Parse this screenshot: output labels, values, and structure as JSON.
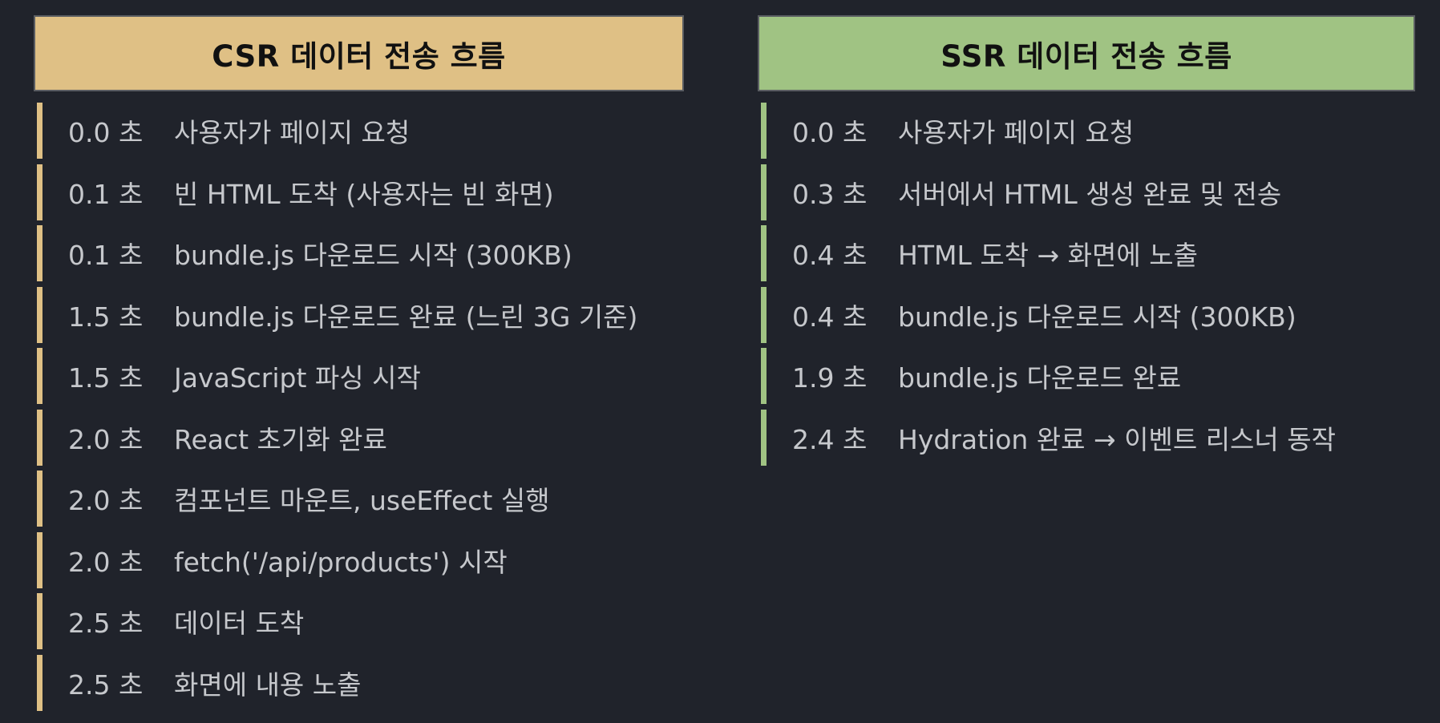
{
  "colors": {
    "background": "#20232b",
    "csr_accent": "#dfc085",
    "ssr_accent": "#a0c383",
    "text": "#c6c8cc"
  },
  "csr": {
    "title": "CSR 데이터 전송 흐름",
    "steps": [
      {
        "time": "0.0 초",
        "desc": "사용자가 페이지 요청"
      },
      {
        "time": "0.1 초",
        "desc": "빈 HTML 도착 (사용자는 빈 화면)"
      },
      {
        "time": "0.1 초",
        "desc": "bundle.js 다운로드 시작 (300KB)"
      },
      {
        "time": "1.5 초",
        "desc": "bundle.js 다운로드 완료 (느린 3G 기준)"
      },
      {
        "time": "1.5 초",
        "desc": "JavaScript 파싱 시작"
      },
      {
        "time": "2.0 초",
        "desc": "React 초기화 완료"
      },
      {
        "time": "2.0 초",
        "desc": "컴포넌트 마운트, useEffect 실행"
      },
      {
        "time": "2.0 초",
        "desc": "fetch('/api/products') 시작"
      },
      {
        "time": "2.5 초",
        "desc": "데이터 도착"
      },
      {
        "time": "2.5 초",
        "desc": "화면에 내용 노출"
      }
    ]
  },
  "ssr": {
    "title": "SSR 데이터 전송 흐름",
    "steps": [
      {
        "time": "0.0 초",
        "desc": "사용자가 페이지 요청"
      },
      {
        "time": "0.3 초",
        "desc": "서버에서 HTML 생성 완료 및 전송"
      },
      {
        "time": "0.4 초",
        "desc": "HTML 도착 → 화면에 노출"
      },
      {
        "time": "0.4 초",
        "desc": "bundle.js 다운로드 시작 (300KB)"
      },
      {
        "time": "1.9 초",
        "desc": "bundle.js 다운로드 완료"
      },
      {
        "time": "2.4 초",
        "desc": "Hydration 완료 → 이벤트 리스너 동작"
      }
    ]
  }
}
